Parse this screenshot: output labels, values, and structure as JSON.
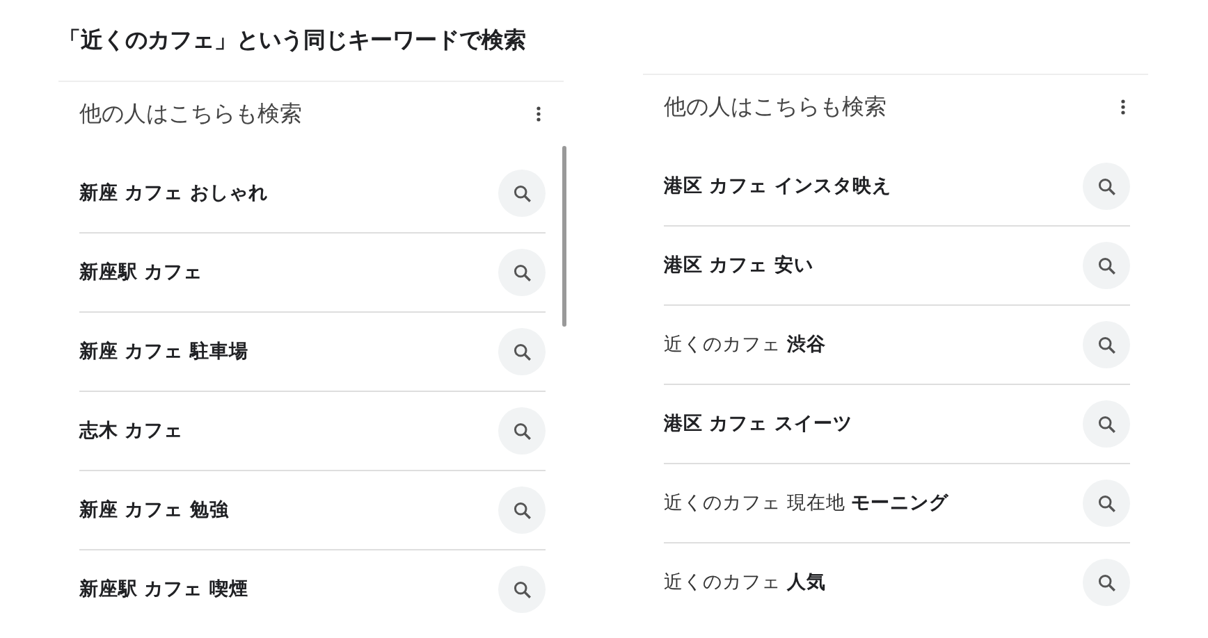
{
  "title": "「近くのカフェ」という同じキーワードで検索",
  "panels": [
    {
      "heading": "他の人はこちらも検索",
      "scrollbar": true,
      "queries": [
        {
          "text": "新座 カフェ おしゃれ",
          "bold": true
        },
        {
          "text": "新座駅 カフェ",
          "bold": true
        },
        {
          "text": "新座 カフェ 駐車場",
          "bold": true
        },
        {
          "text": "志木 カフェ",
          "bold": true
        },
        {
          "text": "新座 カフェ 勉強",
          "bold": true
        },
        {
          "text": "新座駅 カフェ 喫煙",
          "bold": true
        }
      ]
    },
    {
      "heading": "他の人はこちらも検索",
      "scrollbar": false,
      "queries": [
        {
          "text": "港区 カフェ インスタ映え",
          "bold": true
        },
        {
          "text": "港区 カフェ 安い",
          "bold": true
        },
        {
          "text": "近くのカフェ **渋谷**",
          "bold": false
        },
        {
          "text": "港区 カフェ スイーツ",
          "bold": true
        },
        {
          "text": "近くのカフェ 現在地 **モーニング**",
          "bold": false
        },
        {
          "text": "近くのカフェ **人気**",
          "bold": false
        }
      ]
    }
  ]
}
